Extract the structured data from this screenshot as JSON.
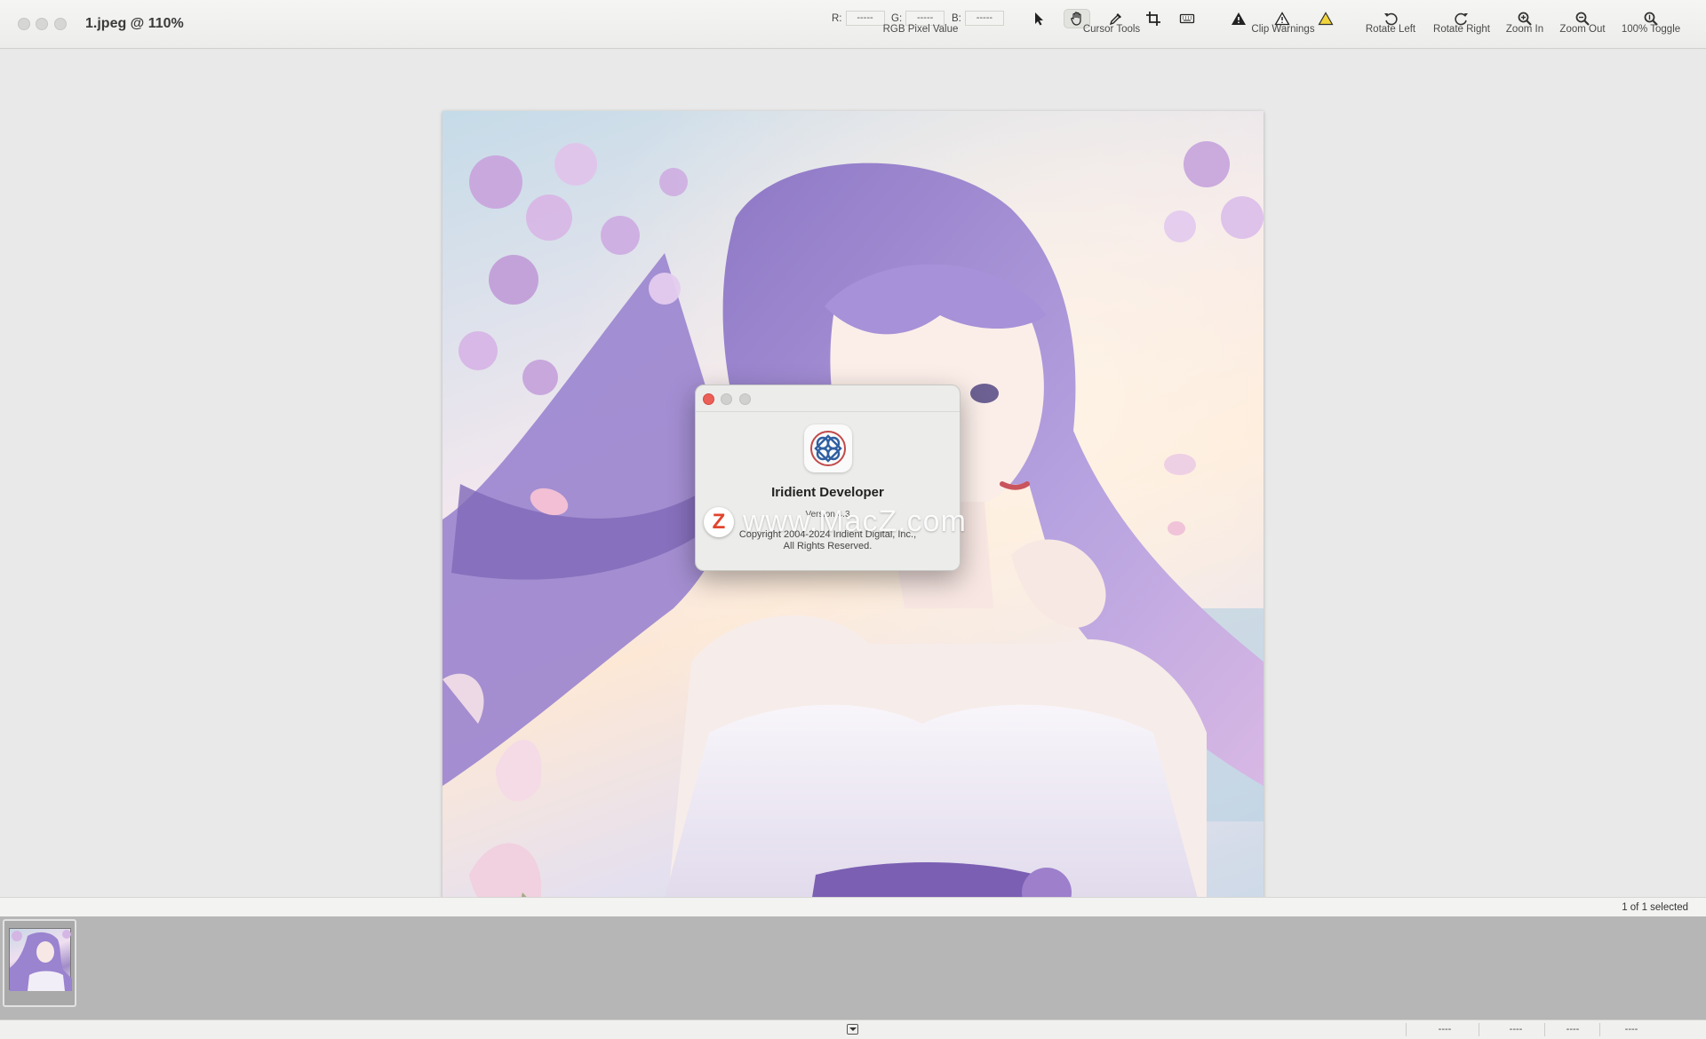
{
  "window": {
    "title": "1.jpeg @ 110%"
  },
  "toolbar": {
    "rgb": {
      "r_label": "R:",
      "g_label": "G:",
      "b_label": "B:",
      "r_value": "-----",
      "g_value": "-----",
      "b_value": "-----",
      "group_label": "RGB Pixel Value"
    },
    "cursor_tools": {
      "group_label": "Cursor Tools",
      "tools": [
        {
          "icon": "arrow-pointer-icon"
        },
        {
          "icon": "hand-icon",
          "active": true
        },
        {
          "icon": "eyedropper-icon"
        },
        {
          "icon": "crop-icon"
        },
        {
          "icon": "keyboard-icon"
        }
      ]
    },
    "clip_warnings": {
      "group_label": "Clip Warnings",
      "icons": [
        "warning-filled-icon",
        "warning-outline-icon",
        "warning-yellow-icon"
      ]
    },
    "rotate_left_label": "Rotate Left",
    "rotate_right_label": "Rotate Right",
    "zoom_in_label": "Zoom In",
    "zoom_out_label": "Zoom Out",
    "zoom_toggle_label": "100% Toggle"
  },
  "about_dialog": {
    "app_name": "Iridient Developer",
    "version": "Version 4.3",
    "copyright_line1": "Copyright 2004-2024 Iridient Digital, Inc.,",
    "copyright_line2": "All Rights Reserved."
  },
  "watermark": {
    "badge": "Z",
    "text": "www.MacZ.com"
  },
  "browser": {
    "selection_count": "1 of 1 selected"
  },
  "statusbar": {
    "cells": [
      "----",
      "----",
      "----",
      "----"
    ]
  },
  "colors": {
    "accent_close": "#ec5f57",
    "warning_yellow": "#e8c22a"
  }
}
